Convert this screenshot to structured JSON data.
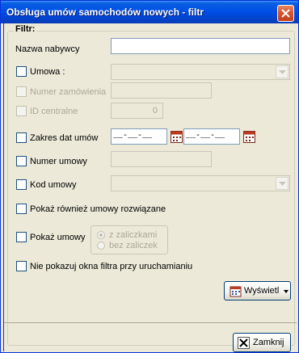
{
  "window": {
    "title": "Obsługa umów samochodów nowych - filtr"
  },
  "filter_group": {
    "label": "Filtr:"
  },
  "fields": {
    "nazwa_nabywcy": {
      "label": "Nazwa nabywcy",
      "value": ""
    },
    "umowa": {
      "label": "Umowa :",
      "value": ""
    },
    "numer_zamowienia": {
      "label": "Numer zamówienia",
      "value": ""
    },
    "id_centralne": {
      "label": "ID centralne",
      "value": "0"
    },
    "zakres_dat": {
      "label": "Zakres dat umów",
      "from": "__-__-__",
      "to": "__-__-__"
    },
    "numer_umowy": {
      "label": "Numer umowy",
      "value": ""
    },
    "kod_umowy": {
      "label": "Kod umowy",
      "value": ""
    },
    "pokaz_rozwiazane": {
      "label": "Pokaż również umowy rozwiązane"
    },
    "pokaz_umowy": {
      "label": "Pokaż umowy",
      "options": [
        "z zaliczkami",
        "bez zaliczek"
      ],
      "selected": "z zaliczkami"
    },
    "nie_pokazuj": {
      "label": "Nie pokazuj okna filtra przy uruchamianiu"
    }
  },
  "buttons": {
    "wyswietl": "Wyświetl",
    "zamknij": "Zamknij"
  },
  "colors": {
    "titlebar": "#0050e6",
    "dialog_bg": "#ece9d8",
    "close_button": "#d4522b"
  }
}
